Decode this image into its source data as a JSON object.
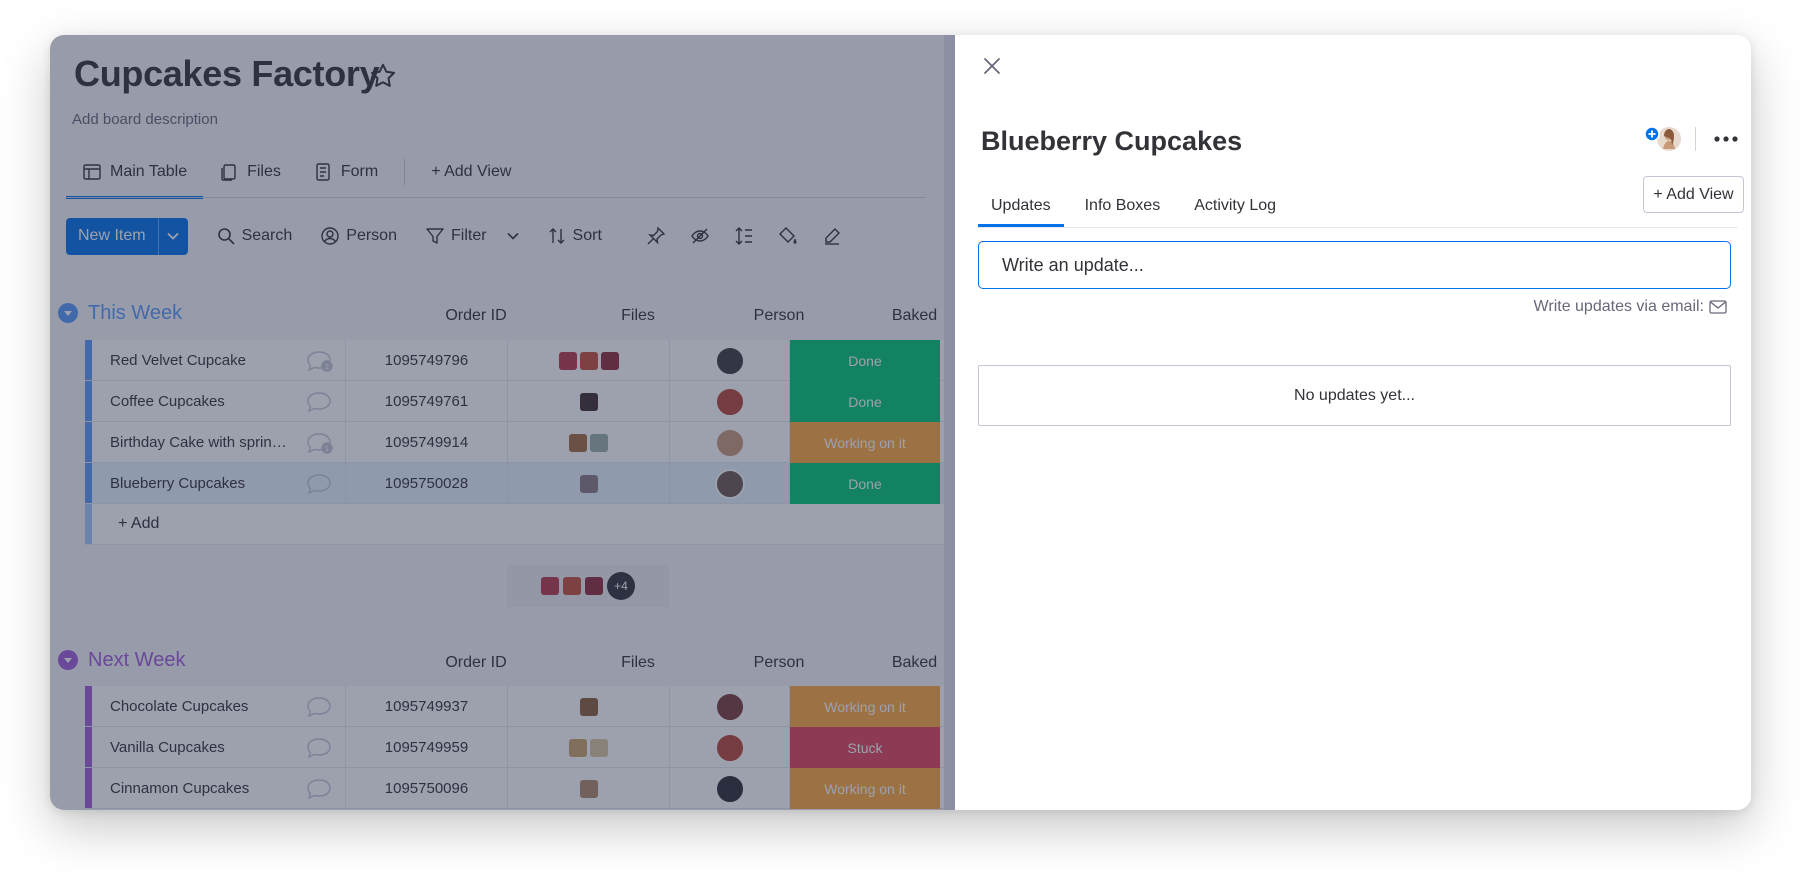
{
  "board": {
    "title": "Cupcakes Factory",
    "description": "Add board description",
    "views": [
      {
        "label": "Main Table",
        "icon": "table-icon",
        "active": true
      },
      {
        "label": "Files",
        "icon": "files-icon",
        "active": false
      },
      {
        "label": "Form",
        "icon": "form-icon",
        "active": false
      }
    ],
    "add_view_label": "+ Add View",
    "toolbar": {
      "new_item": "New Item",
      "search": "Search",
      "person": "Person",
      "filter": "Filter",
      "sort": "Sort"
    },
    "columns": {
      "order_id": "Order ID",
      "files": "Files",
      "person": "Person",
      "baked": "Baked"
    },
    "groups": [
      {
        "title": "This Week",
        "color": "#579bfc",
        "rows": [
          {
            "name": "Red Velvet Cupcake",
            "order_id": "1095749796",
            "files": 3,
            "baked": "Done",
            "baked_color": "#00c875",
            "updates": "2"
          },
          {
            "name": "Coffee Cupcakes",
            "order_id": "1095749761",
            "files": 1,
            "baked": "Done",
            "baked_color": "#00c875",
            "updates": ""
          },
          {
            "name": "Birthday Cake with sprink...",
            "order_id": "1095749914",
            "files": 2,
            "baked": "Working on it",
            "baked_color": "#fdab3d",
            "updates": "1"
          },
          {
            "name": "Blueberry Cupcakes",
            "order_id": "1095750028",
            "files": 1,
            "baked": "Done",
            "baked_color": "#00c875",
            "updates": "",
            "selected": true
          }
        ],
        "add_label": "+ Add",
        "summary_more": "+4"
      },
      {
        "title": "Next Week",
        "color": "#a25ddc",
        "rows": [
          {
            "name": "Chocolate Cupcakes",
            "order_id": "1095749937",
            "files": 1,
            "baked": "Working on it",
            "baked_color": "#fdab3d",
            "updates": ""
          },
          {
            "name": "Vanilla Cupcakes",
            "order_id": "1095749959",
            "files": 2,
            "baked": "Stuck",
            "baked_color": "#e2445c",
            "updates": ""
          },
          {
            "name": "Cinnamon Cupcakes",
            "order_id": "1095750096",
            "files": 1,
            "baked": "Working on it",
            "baked_color": "#fdab3d",
            "updates": ""
          }
        ]
      }
    ]
  },
  "panel": {
    "item_title": "Blueberry Cupcakes",
    "tabs": [
      {
        "label": "Updates",
        "active": true
      },
      {
        "label": "Info Boxes",
        "active": false
      },
      {
        "label": "Activity Log",
        "active": false
      }
    ],
    "add_view": "+ Add View",
    "update_placeholder": "Write an update...",
    "email_hint": "Write updates via email:",
    "empty_state": "No updates yet..."
  },
  "colors": {
    "accent": "#0073ea",
    "done": "#00c875",
    "working": "#fdab3d",
    "stuck": "#e2445c"
  }
}
